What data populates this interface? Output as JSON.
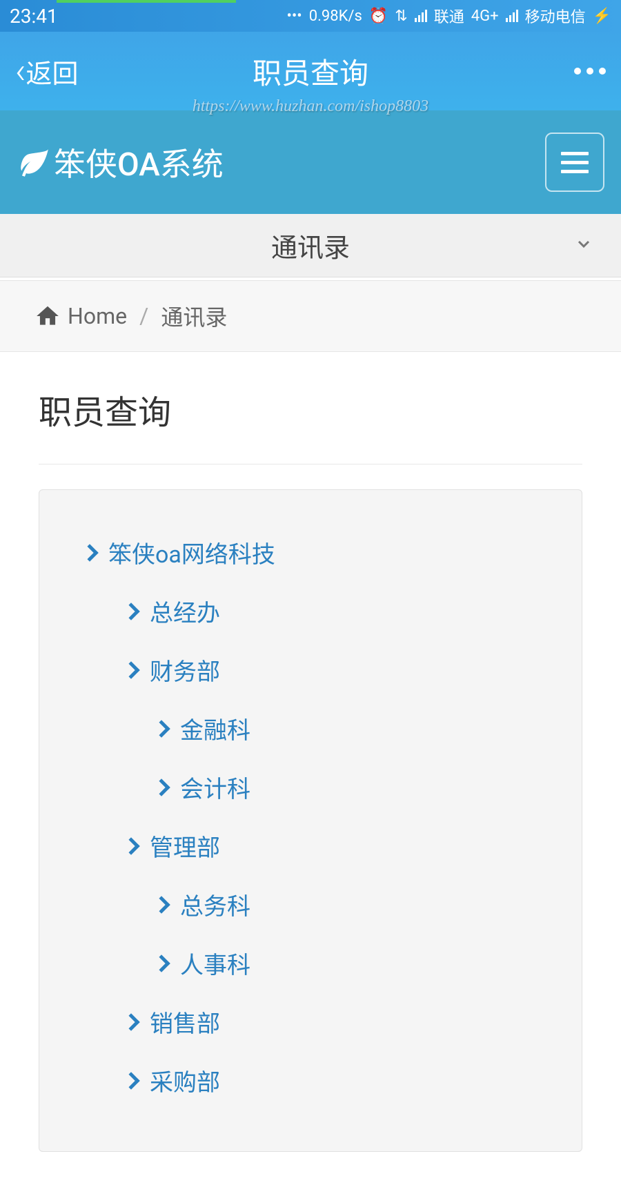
{
  "status_bar": {
    "time": "23:41",
    "network_speed": "0.98K/s",
    "carrier1": "联通",
    "carrier1_type": "4G+",
    "carrier2": "移动电信"
  },
  "top_nav": {
    "back_label": "返回",
    "title": "职员查询",
    "watermark": "https://www.huzhan.com/ishop8803"
  },
  "app_header": {
    "app_name": "笨侠OA系统"
  },
  "dropdown": {
    "label": "通讯录"
  },
  "breadcrumb": {
    "home_label": "Home",
    "current": "通讯录"
  },
  "content": {
    "title": "职员查询"
  },
  "tree": {
    "items": [
      {
        "label": "笨侠oa网络科技",
        "level": 0
      },
      {
        "label": "总经办",
        "level": 1
      },
      {
        "label": "财务部",
        "level": 1
      },
      {
        "label": "金融科",
        "level": 2
      },
      {
        "label": "会计科",
        "level": 2
      },
      {
        "label": "管理部",
        "level": 1
      },
      {
        "label": "总务科",
        "level": 2
      },
      {
        "label": "人事科",
        "level": 2
      },
      {
        "label": "销售部",
        "level": 1
      },
      {
        "label": "采购部",
        "level": 1
      }
    ]
  }
}
